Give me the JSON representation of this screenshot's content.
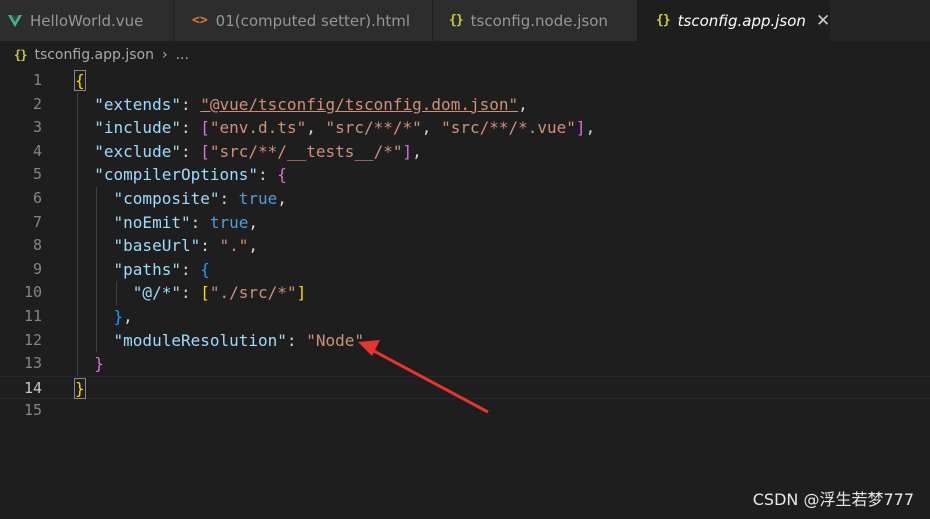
{
  "tabs": [
    {
      "label": "HelloWorld.vue",
      "icon": "vue-icon"
    },
    {
      "label": "01(computed setter).html",
      "icon": "html-icon"
    },
    {
      "label": "tsconfig.node.json",
      "icon": "json-icon"
    },
    {
      "label": "tsconfig.app.json",
      "icon": "json-icon",
      "active": true,
      "close": "✕"
    }
  ],
  "icon_glyphs": {
    "json": "{}",
    "html": "<>",
    "close": "✕",
    "chevron": "›"
  },
  "breadcrumb": {
    "file": "tsconfig.app.json",
    "rest": "..."
  },
  "line_numbers": [
    "1",
    "2",
    "3",
    "4",
    "5",
    "6",
    "7",
    "8",
    "9",
    "10",
    "11",
    "12",
    "13",
    "14",
    "15"
  ],
  "code": {
    "l2_key": "\"extends\"",
    "l2_val": "\"@vue/tsconfig/tsconfig.dom.json\"",
    "l3_key": "\"include\"",
    "l3_v1": "\"env.d.ts\"",
    "l3_v2": "\"src/**/*\"",
    "l3_v3": "\"src/**/*.vue\"",
    "l4_key": "\"exclude\"",
    "l4_v1": "\"src/**/__tests__/*\"",
    "l5_key": "\"compilerOptions\"",
    "l6_key": "\"composite\"",
    "l6_val": "true",
    "l7_key": "\"noEmit\"",
    "l7_val": "true",
    "l8_key": "\"baseUrl\"",
    "l8_val": "\".\"",
    "l9_key": "\"paths\"",
    "l10_key": "\"@/*\"",
    "l10_v1": "\"./src/*\"",
    "l12_key": "\"moduleResolution\"",
    "l12_val": "\"Node\""
  },
  "watermark": "CSDN @浮生若梦777",
  "colors": {
    "background": "#1e1e1e",
    "tab_bar": "#252526",
    "key": "#9cdcfe",
    "string": "#ce9178",
    "keyword": "#569cd6",
    "annotation_arrow": "#e8332f"
  }
}
